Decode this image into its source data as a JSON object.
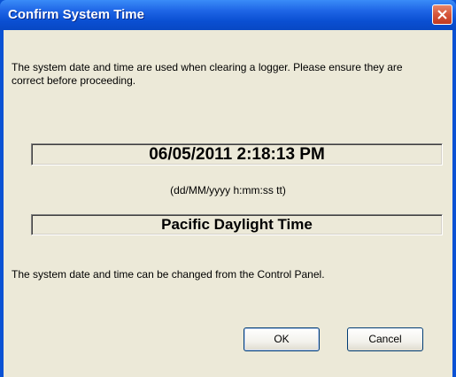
{
  "window": {
    "title": "Confirm System Time"
  },
  "dialog": {
    "intro_text": "The system date and time are used when clearing a logger. Please ensure they are correct before proceeding.",
    "datetime_value": "06/05/2011 2:18:13 PM",
    "format_hint": "(dd/MM/yyyy h:mm:ss tt)",
    "timezone_value": "Pacific Daylight Time",
    "note_text": "The system date and time can be changed from the Control Panel."
  },
  "buttons": {
    "ok_label": "OK",
    "cancel_label": "Cancel"
  },
  "icons": {
    "close": "close-icon"
  },
  "colors": {
    "titlebar": "#0a52d4",
    "client_bg": "#ece9d8",
    "close_button": "#d5553a"
  }
}
